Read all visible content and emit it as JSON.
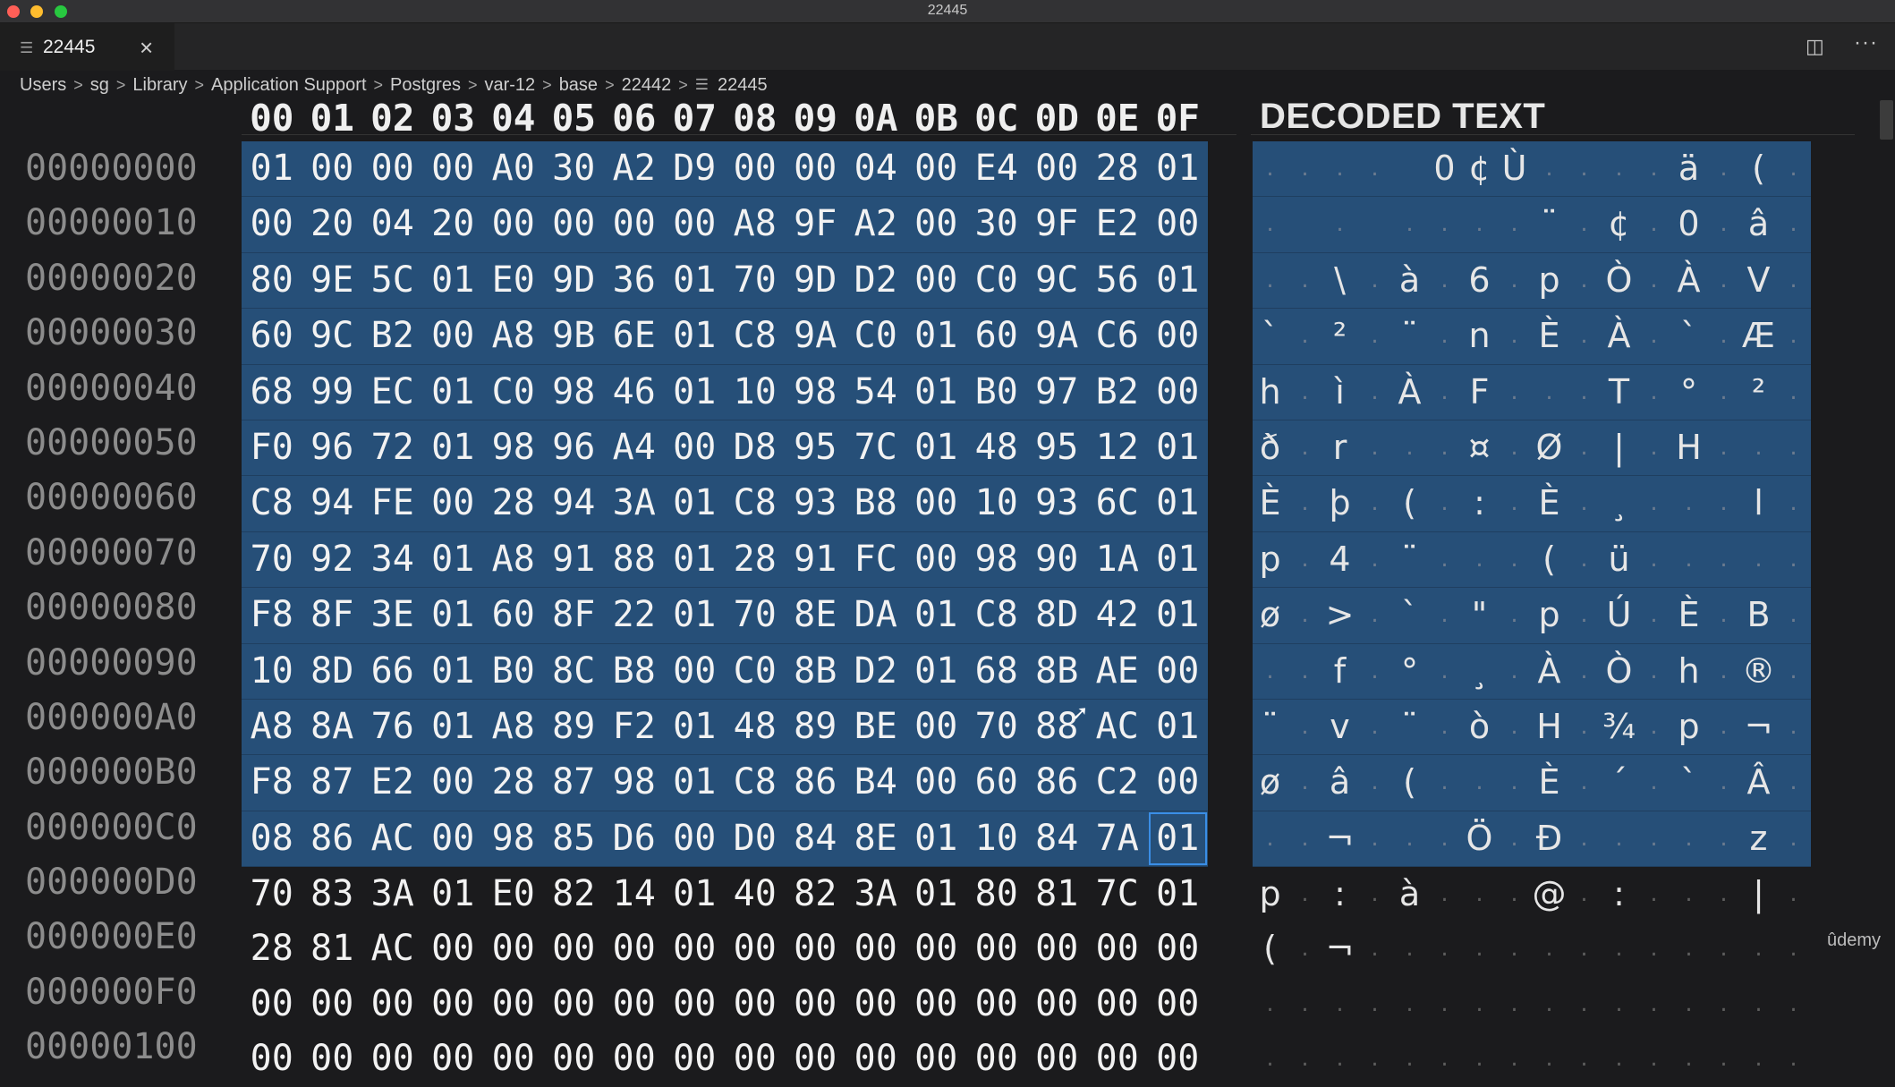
{
  "window": {
    "title": "22445"
  },
  "tab": {
    "label": "22445",
    "icon": "lines-icon",
    "close": "×"
  },
  "toolbar": {
    "split_glyph": "◫",
    "more_glyph": "···"
  },
  "breadcrumb": {
    "items": [
      "Users",
      "sg",
      "Library",
      "Application Support",
      "Postgres",
      "var-12",
      "base",
      "22442"
    ],
    "file": "22445",
    "separator": ">"
  },
  "hex_header": [
    "00",
    "01",
    "02",
    "03",
    "04",
    "05",
    "06",
    "07",
    "08",
    "09",
    "0A",
    "0B",
    "0C",
    "0D",
    "0E",
    "0F"
  ],
  "decoded_title": "DECODED TEXT",
  "rows": [
    {
      "offset": "00000000",
      "bytes": [
        "01",
        "00",
        "00",
        "00",
        "A0",
        "30",
        "A2",
        "D9",
        "00",
        "00",
        "04",
        "00",
        "E4",
        "00",
        "28",
        "01"
      ],
      "text": [
        ".",
        ".",
        ".",
        ".",
        "",
        "0",
        "¢",
        "Ù",
        ".",
        ".",
        ".",
        ".",
        "ä",
        ".",
        "(",
        "."
      ],
      "selected": true
    },
    {
      "offset": "00000010",
      "bytes": [
        "00",
        "20",
        "04",
        "20",
        "00",
        "00",
        "00",
        "00",
        "A8",
        "9F",
        "A2",
        "00",
        "30",
        "9F",
        "E2",
        "00"
      ],
      "text": [
        ".",
        "",
        ".",
        "",
        ".",
        ".",
        ".",
        ".",
        "¨",
        ".",
        "¢",
        ".",
        "0",
        ".",
        "â",
        "."
      ],
      "selected": true
    },
    {
      "offset": "00000020",
      "bytes": [
        "80",
        "9E",
        "5C",
        "01",
        "E0",
        "9D",
        "36",
        "01",
        "70",
        "9D",
        "D2",
        "00",
        "C0",
        "9C",
        "56",
        "01"
      ],
      "text": [
        ".",
        ".",
        "\\",
        ".",
        "à",
        ".",
        "6",
        ".",
        "p",
        ".",
        "Ò",
        ".",
        "À",
        ".",
        "V",
        "."
      ],
      "selected": true
    },
    {
      "offset": "00000030",
      "bytes": [
        "60",
        "9C",
        "B2",
        "00",
        "A8",
        "9B",
        "6E",
        "01",
        "C8",
        "9A",
        "C0",
        "01",
        "60",
        "9A",
        "C6",
        "00"
      ],
      "text": [
        "`",
        ".",
        "²",
        ".",
        "¨",
        ".",
        "n",
        ".",
        "È",
        ".",
        "À",
        ".",
        "`",
        ".",
        "Æ",
        "."
      ],
      "selected": true
    },
    {
      "offset": "00000040",
      "bytes": [
        "68",
        "99",
        "EC",
        "01",
        "C0",
        "98",
        "46",
        "01",
        "10",
        "98",
        "54",
        "01",
        "B0",
        "97",
        "B2",
        "00"
      ],
      "text": [
        "h",
        ".",
        "ì",
        ".",
        "À",
        ".",
        "F",
        ".",
        ".",
        ".",
        "T",
        ".",
        "°",
        ".",
        "²",
        "."
      ],
      "selected": true
    },
    {
      "offset": "00000050",
      "bytes": [
        "F0",
        "96",
        "72",
        "01",
        "98",
        "96",
        "A4",
        "00",
        "D8",
        "95",
        "7C",
        "01",
        "48",
        "95",
        "12",
        "01"
      ],
      "text": [
        "ð",
        ".",
        "r",
        ".",
        ".",
        ".",
        "¤",
        ".",
        "Ø",
        ".",
        "|",
        ".",
        "H",
        ".",
        ".",
        "."
      ],
      "selected": true
    },
    {
      "offset": "00000060",
      "bytes": [
        "C8",
        "94",
        "FE",
        "00",
        "28",
        "94",
        "3A",
        "01",
        "C8",
        "93",
        "B8",
        "00",
        "10",
        "93",
        "6C",
        "01"
      ],
      "text": [
        "È",
        ".",
        "þ",
        ".",
        "(",
        ".",
        ":",
        ".",
        "È",
        ".",
        "¸",
        ".",
        ".",
        ".",
        "l",
        "."
      ],
      "selected": true
    },
    {
      "offset": "00000070",
      "bytes": [
        "70",
        "92",
        "34",
        "01",
        "A8",
        "91",
        "88",
        "01",
        "28",
        "91",
        "FC",
        "00",
        "98",
        "90",
        "1A",
        "01"
      ],
      "text": [
        "p",
        ".",
        "4",
        ".",
        "¨",
        ".",
        ".",
        ".",
        "(",
        ".",
        "ü",
        ".",
        ".",
        ".",
        ".",
        "."
      ],
      "selected": true
    },
    {
      "offset": "00000080",
      "bytes": [
        "F8",
        "8F",
        "3E",
        "01",
        "60",
        "8F",
        "22",
        "01",
        "70",
        "8E",
        "DA",
        "01",
        "C8",
        "8D",
        "42",
        "01"
      ],
      "text": [
        "ø",
        ".",
        ">",
        ".",
        "`",
        ".",
        "\"",
        ".",
        "p",
        ".",
        "Ú",
        ".",
        "È",
        ".",
        "B",
        "."
      ],
      "selected": true
    },
    {
      "offset": "00000090",
      "bytes": [
        "10",
        "8D",
        "66",
        "01",
        "B0",
        "8C",
        "B8",
        "00",
        "C0",
        "8B",
        "D2",
        "01",
        "68",
        "8B",
        "AE",
        "00"
      ],
      "text": [
        ".",
        ".",
        "f",
        ".",
        "°",
        ".",
        "¸",
        ".",
        "À",
        ".",
        "Ò",
        ".",
        "h",
        ".",
        "®",
        "."
      ],
      "selected": true
    },
    {
      "offset": "000000A0",
      "bytes": [
        "A8",
        "8A",
        "76",
        "01",
        "A8",
        "89",
        "F2",
        "01",
        "48",
        "89",
        "BE",
        "00",
        "70",
        "88",
        "AC",
        "01"
      ],
      "text": [
        "¨",
        ".",
        "v",
        ".",
        "¨",
        ".",
        "ò",
        ".",
        "H",
        ".",
        "¾",
        ".",
        "p",
        ".",
        "¬",
        "."
      ],
      "selected": true
    },
    {
      "offset": "000000B0",
      "bytes": [
        "F8",
        "87",
        "E2",
        "00",
        "28",
        "87",
        "98",
        "01",
        "C8",
        "86",
        "B4",
        "00",
        "60",
        "86",
        "C2",
        "00"
      ],
      "text": [
        "ø",
        ".",
        "â",
        ".",
        "(",
        ".",
        ".",
        ".",
        "È",
        ".",
        "´",
        ".",
        "`",
        ".",
        "Â",
        "."
      ],
      "selected": true
    },
    {
      "offset": "000000C0",
      "bytes": [
        "08",
        "86",
        "AC",
        "00",
        "98",
        "85",
        "D6",
        "00",
        "D0",
        "84",
        "8E",
        "01",
        "10",
        "84",
        "7A",
        "01"
      ],
      "text": [
        ".",
        ".",
        "¬",
        ".",
        ".",
        ".",
        "Ö",
        ".",
        "Ð",
        ".",
        ".",
        ".",
        ".",
        ".",
        "z",
        "."
      ],
      "selected": true
    },
    {
      "offset": "000000D0",
      "bytes": [
        "70",
        "83",
        "3A",
        "01",
        "E0",
        "82",
        "14",
        "01",
        "40",
        "82",
        "3A",
        "01",
        "80",
        "81",
        "7C",
        "01"
      ],
      "text": [
        "p",
        ".",
        ":",
        ".",
        "à",
        ".",
        ".",
        ".",
        "@",
        ".",
        ":",
        ".",
        ".",
        ".",
        "|",
        "."
      ],
      "selected": false
    },
    {
      "offset": "000000E0",
      "bytes": [
        "28",
        "81",
        "AC",
        "00",
        "00",
        "00",
        "00",
        "00",
        "00",
        "00",
        "00",
        "00",
        "00",
        "00",
        "00",
        "00"
      ],
      "text": [
        "(",
        ".",
        "¬",
        ".",
        ".",
        ".",
        ".",
        ".",
        ".",
        ".",
        ".",
        ".",
        ".",
        ".",
        ".",
        "."
      ],
      "selected": false
    },
    {
      "offset": "000000F0",
      "bytes": [
        "00",
        "00",
        "00",
        "00",
        "00",
        "00",
        "00",
        "00",
        "00",
        "00",
        "00",
        "00",
        "00",
        "00",
        "00",
        "00"
      ],
      "text": [
        ".",
        ".",
        ".",
        ".",
        ".",
        ".",
        ".",
        ".",
        ".",
        ".",
        ".",
        ".",
        ".",
        ".",
        ".",
        "."
      ],
      "selected": false
    },
    {
      "offset": "00000100",
      "bytes": [
        "00",
        "00",
        "00",
        "00",
        "00",
        "00",
        "00",
        "00",
        "00",
        "00",
        "00",
        "00",
        "00",
        "00",
        "00",
        "00"
      ],
      "text": [
        ".",
        ".",
        ".",
        ".",
        ".",
        ".",
        ".",
        ".",
        ".",
        ".",
        ".",
        ".",
        ".",
        ".",
        ".",
        "."
      ],
      "selected": false
    }
  ],
  "focused_cell": {
    "row": 12,
    "col": 15
  },
  "watermark": "ûdemy",
  "colors": {
    "selection": "#264f78",
    "focus": "#3a8ee6",
    "background": "#1b1b1d"
  }
}
